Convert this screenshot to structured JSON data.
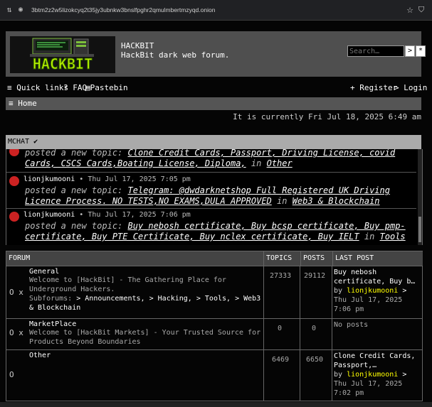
{
  "browser": {
    "url": "3btm2z2w5lizokcyq2t35jy3ubnkw3bnslfpghr2qmulmbertmzyqd.onion"
  },
  "header": {
    "logo_text": "HACKBIT",
    "site_title": "HACKBIT",
    "site_desc": "HackBit dark web forum.",
    "search_placeholder": "Search…",
    "search_btn": ">",
    "adv_btn": "*"
  },
  "nav": {
    "quick_links": "≡ Quick links",
    "faq": "? FAQ",
    "pastebin": "Pastebin",
    "register": "+ Register",
    "login": "> Login"
  },
  "breadcrumb": "≡ Home",
  "current_time": "It is currently Fri Jul 18, 2025 6:49 am",
  "mchat": {
    "title": "MCHAT ✔",
    "messages": [
      {
        "user": "",
        "time": "",
        "text": "posted a new topic:",
        "topic": "Clone Credit Cards, Passport, Driving License, covid Cards, CSCS Cards,Boating License, Diploma,",
        "in": "in",
        "forum": "Other"
      },
      {
        "user": "lionjkumooni",
        "time": "• Thu Jul 17, 2025 7:05 pm",
        "text": "posted a new topic:",
        "topic": "Telegram: @dwdarknetshop Full Registered UK Driving Licence Process. NO TESTS,NO EXAMS,DULA APPROVED",
        "in": "in",
        "forum": "Web3 & Blockchain"
      },
      {
        "user": "lionjkumooni",
        "time": "• Thu Jul 17, 2025 7:06 pm",
        "text": "posted a new topic:",
        "topic": "Buy nebosh certificate, Buy bcsp certificate, Buy pmp-certificate, Buy PTE Certificate, Buy nclex certificate, Buy IELT",
        "in": "in",
        "forum": "Tools"
      }
    ]
  },
  "forum": {
    "headers": {
      "forum": "FORUM",
      "topics": "TOPICS",
      "posts": "POSTS",
      "last": "LAST POST"
    },
    "rows": [
      {
        "icons": "O x",
        "title": "General",
        "desc": "Welcome to [HackBit] - The Gathering Place for Underground Hackers.",
        "subforums_label": "Subforums:",
        "subforums": [
          "> Announcements,",
          "> Hacking,",
          "> Tools,",
          "> Web3 & Blockchain"
        ],
        "topics": "27333",
        "posts": "29112",
        "last_title": "Buy nebosh certificate, Buy b…",
        "last_by": "by",
        "last_user": "lionjkumooni",
        "last_go": ">",
        "last_date": "Thu Jul 17, 2025",
        "last_time": "7:06 pm"
      },
      {
        "icons": "O x",
        "title": "MarketPlace",
        "desc": "Welcome to [HackBit Markets] - Your Trusted Source for Products Beyond Boundaries",
        "topics": "0",
        "posts": "0",
        "last_title": "No posts"
      },
      {
        "icons": "O",
        "title": "Other",
        "desc": "",
        "topics": "6469",
        "posts": "6650",
        "last_title": "Clone Credit Cards, Passport,…",
        "last_by": "by",
        "last_user": "lionjkumooni",
        "last_go": ">",
        "last_date": "Thu Jul 17, 2025",
        "last_time": "7:02 pm"
      }
    ]
  }
}
